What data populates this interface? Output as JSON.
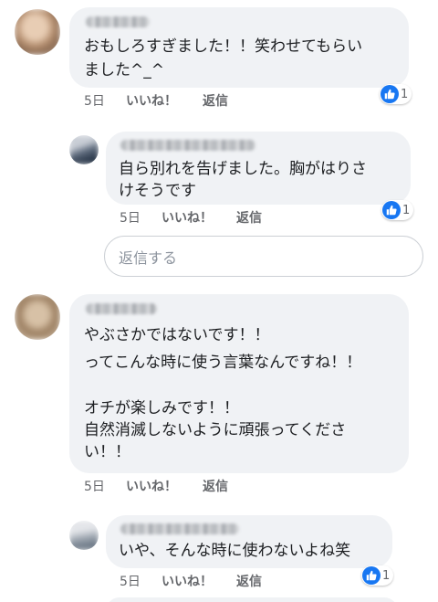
{
  "comments": [
    {
      "text": "おもしろすぎました！！笑わせてもらいました^_^",
      "line1": "おもしろすぎました！！笑わせてもらい",
      "line2": "ました^_^",
      "age": "5日",
      "like_label": "いいね！",
      "reply_label": "返信",
      "reaction_count": "1",
      "replies": [
        {
          "line1": "自ら別れを告げました。胸がはりさ",
          "line2": "けそうです",
          "age": "5日",
          "like_label": "いいね！",
          "reply_label": "返信",
          "reaction_count": "1"
        }
      ],
      "reply_input_placeholder": "返信する"
    },
    {
      "lines": [
        "やぶさかではないです！！",
        "ってこんな時に使う言葉なんですね！！",
        "",
        "オチが楽しみです！！",
        "自然消滅しないように頑張ってくださ",
        "い！！"
      ],
      "age": "5日",
      "like_label": "いいね！",
      "reply_label": "返信",
      "replies": [
        {
          "line1": "いや、そんな時に使わないよね笑",
          "age": "5日",
          "like_label": "いいね！",
          "reply_label": "返信",
          "reaction_count": "1"
        }
      ]
    }
  ],
  "colors": {
    "bubble": "#f0f2f5",
    "meta_text": "#65676b",
    "like_blue": "#1877f2"
  }
}
